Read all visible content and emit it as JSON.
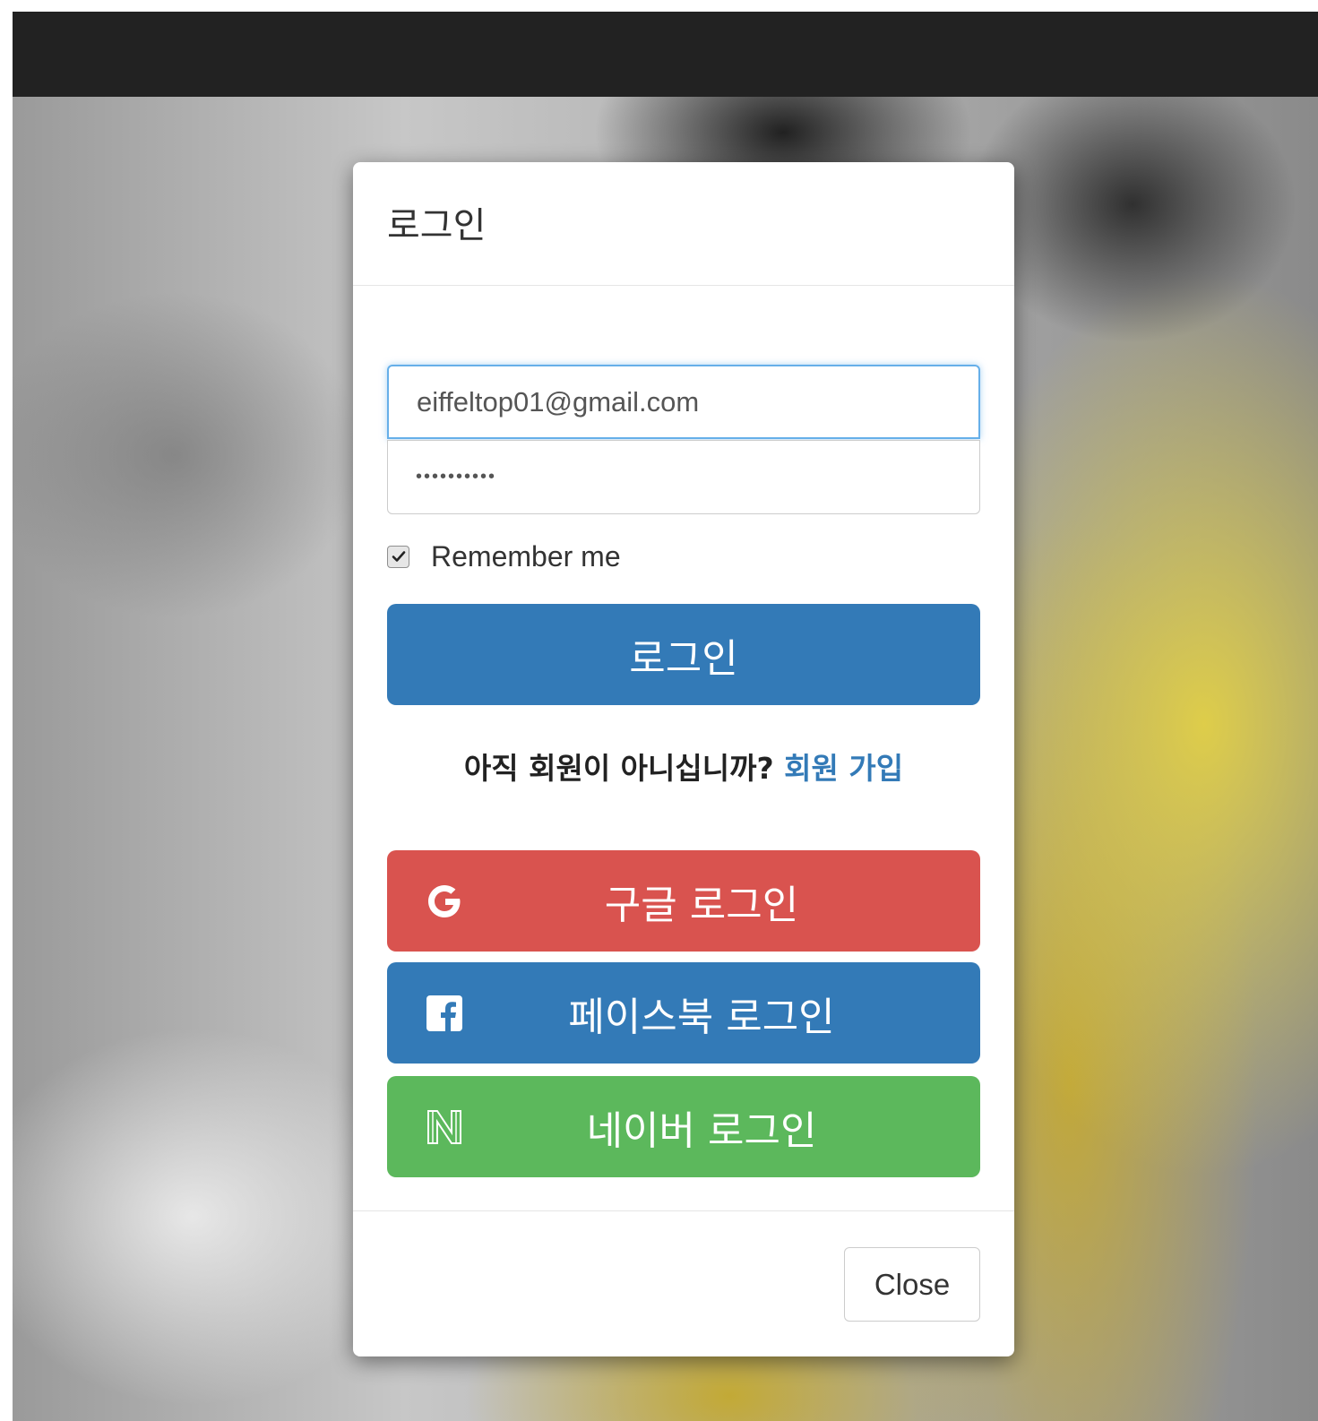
{
  "modal": {
    "title": "로그인",
    "email_value": "eiffeltop01@gmail.com",
    "password_value": "**********",
    "remember_label": "Remember me",
    "remember_checked": true,
    "login_button": "로그인",
    "signup_prompt": "아직 회원이 아니십니까?",
    "signup_link": "회원 가입",
    "social": {
      "google": {
        "label": "구글 로그인",
        "icon": "google-icon",
        "color": "#d9534f"
      },
      "facebook": {
        "label": "페이스북 로그인",
        "icon": "facebook-icon",
        "color": "#337ab7"
      },
      "naver": {
        "label": "네이버 로그인",
        "icon": "naver-icon",
        "color": "#5cb85c"
      }
    },
    "close_button": "Close"
  },
  "colors": {
    "navbar": "#222222",
    "primary": "#337ab7",
    "danger": "#d9534f",
    "success": "#5cb85c"
  }
}
